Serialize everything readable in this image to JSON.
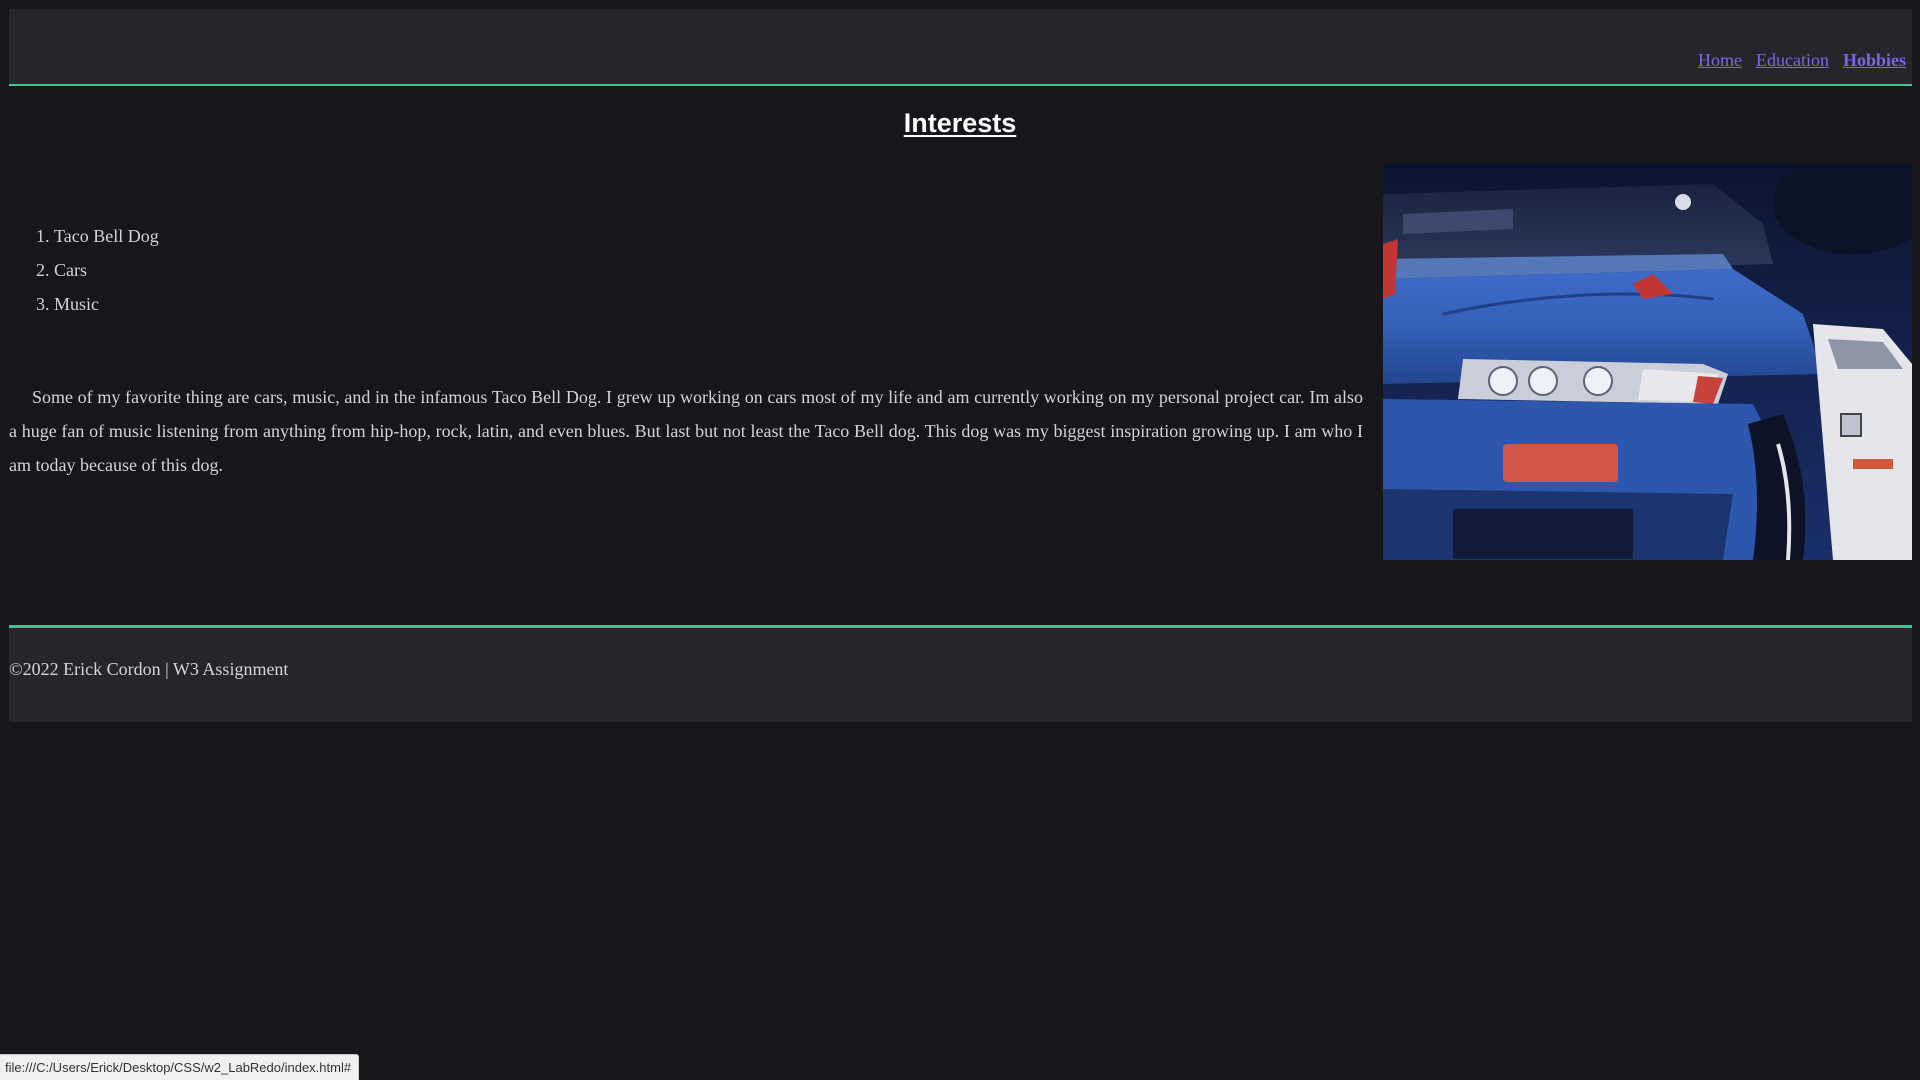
{
  "nav": {
    "items": [
      {
        "label": "Home",
        "active": false
      },
      {
        "label": "Education",
        "active": false
      },
      {
        "label": "Hobbies",
        "active": true
      }
    ]
  },
  "main": {
    "title": "Interests",
    "interests": [
      "Taco Bell Dog",
      "Cars",
      "Music"
    ],
    "paragraph": "Some of my favorite thing are cars, music, and in the infamous Taco Bell Dog. I grew up working on cars most of my life and am currently working on my personal project car. Im also a huge fan of music listening from anything from hip-hop, rock, latin, and even blues. But last but not least the Taco Bell dog. This dog was my biggest inspiration growing up. I am who I am today because of this dog."
  },
  "footer": {
    "copyright": "©2022 Erick Cordon | W3 Assignment"
  },
  "status_bar": {
    "url": "file:///C:/Users/Erick/Desktop/CSS/w2_LabRedo/index.html#"
  },
  "colors": {
    "background": "#16161b",
    "panel": "#25262b",
    "accent": "#3ec58f",
    "link": "#7d64e6"
  }
}
